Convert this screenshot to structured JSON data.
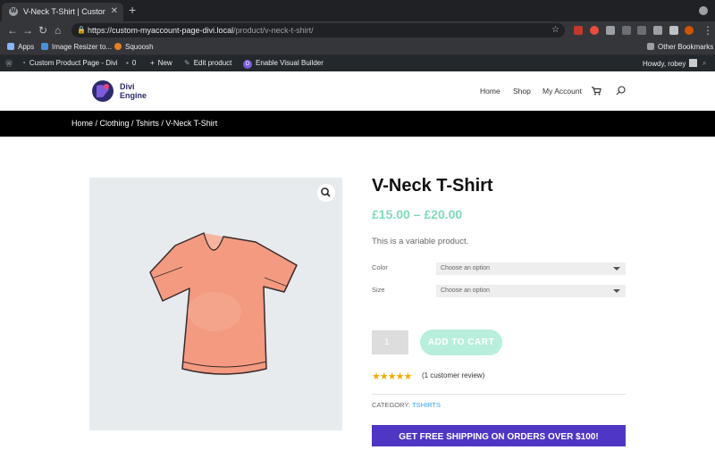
{
  "browser": {
    "tab_title": "V-Neck T-Shirt | Custom Produ",
    "tab_close": "✕",
    "new_tab": "+",
    "url_host": "https://custom-myaccount-page-divi.local",
    "url_path": "/product/v-neck-t-shirt/",
    "bookmarks": [
      "Apps",
      "Image Resizer to...",
      "Squoosh"
    ],
    "other_bookmarks": "Other Bookmarks"
  },
  "adminbar": {
    "site": "Custom Product Page - Divi",
    "comments": "0",
    "new": "New",
    "edit": "Edit product",
    "visual_builder": "Enable Visual Builder",
    "howdy": "Howdy, robey"
  },
  "header": {
    "logo_line1": "Divi",
    "logo_line2": "Engine",
    "nav": [
      "Home",
      "Shop",
      "My Account"
    ]
  },
  "breadcrumb": "Home / Clothing / Tshirts / V-Neck T-Shirt",
  "product": {
    "title": "V-Neck T-Shirt",
    "price": "£15.00 – £20.00",
    "description": "This is a variable product.",
    "attributes": [
      {
        "label": "Color",
        "placeholder": "Choose an option"
      },
      {
        "label": "Size",
        "placeholder": "Choose an option"
      }
    ],
    "quantity": "1",
    "add_to_cart": "ADD TO CART",
    "stars": "★★★★★",
    "reviews": "(1 customer review)",
    "category_label": "CATEGORY:",
    "category_value": "TSHIRTS"
  },
  "banner": "GET FREE SHIPPING ON ORDERS OVER $100!",
  "colors": {
    "accent_green": "#7fdbb6",
    "banner_purple": "#4f36c4",
    "logo_navy": "#2d2a6e"
  }
}
